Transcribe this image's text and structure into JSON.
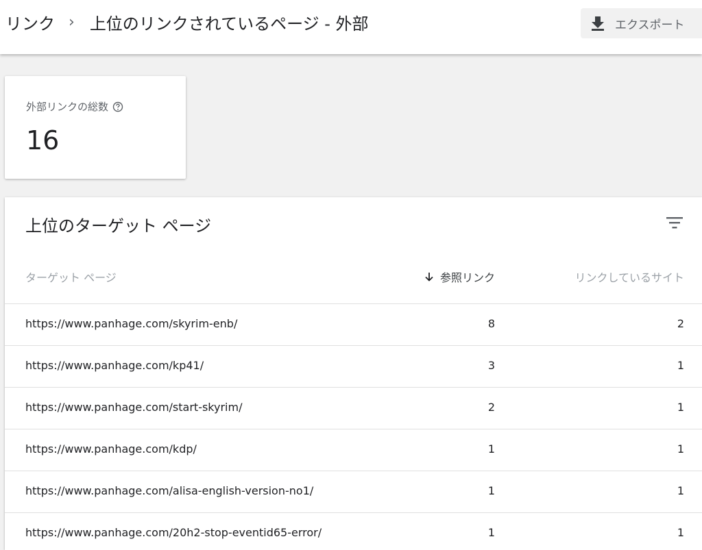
{
  "header": {
    "breadcrumb_parent": "リンク",
    "breadcrumb_separator": "›",
    "title": "上位のリンクされているページ - 外部",
    "export_label": "エクスポート"
  },
  "summary": {
    "label": "外部リンクの総数",
    "value": "16"
  },
  "table": {
    "title": "上位のターゲット ページ",
    "columns": {
      "target_page": "ターゲット ページ",
      "referring_links": "参照リンク",
      "linking_sites": "リンクしているサイト"
    },
    "rows": [
      {
        "url": "https://www.panhage.com/skyrim-enb/",
        "links": "8",
        "sites": "2"
      },
      {
        "url": "https://www.panhage.com/kp41/",
        "links": "3",
        "sites": "1"
      },
      {
        "url": "https://www.panhage.com/start-skyrim/",
        "links": "2",
        "sites": "1"
      },
      {
        "url": "https://www.panhage.com/kdp/",
        "links": "1",
        "sites": "1"
      },
      {
        "url": "https://www.panhage.com/alisa-english-version-no1/",
        "links": "1",
        "sites": "1"
      },
      {
        "url": "https://www.panhage.com/20h2-stop-eventid65-error/",
        "links": "1",
        "sites": "1"
      }
    ]
  },
  "icons": {
    "export": "download-icon",
    "help": "help-circle-icon",
    "filter": "filter-icon",
    "sort": "arrow-down-icon"
  },
  "colors": {
    "background": "#f1f1f1",
    "text_primary": "#202124",
    "text_secondary": "#5f6368",
    "divider": "#e0e0e0"
  }
}
